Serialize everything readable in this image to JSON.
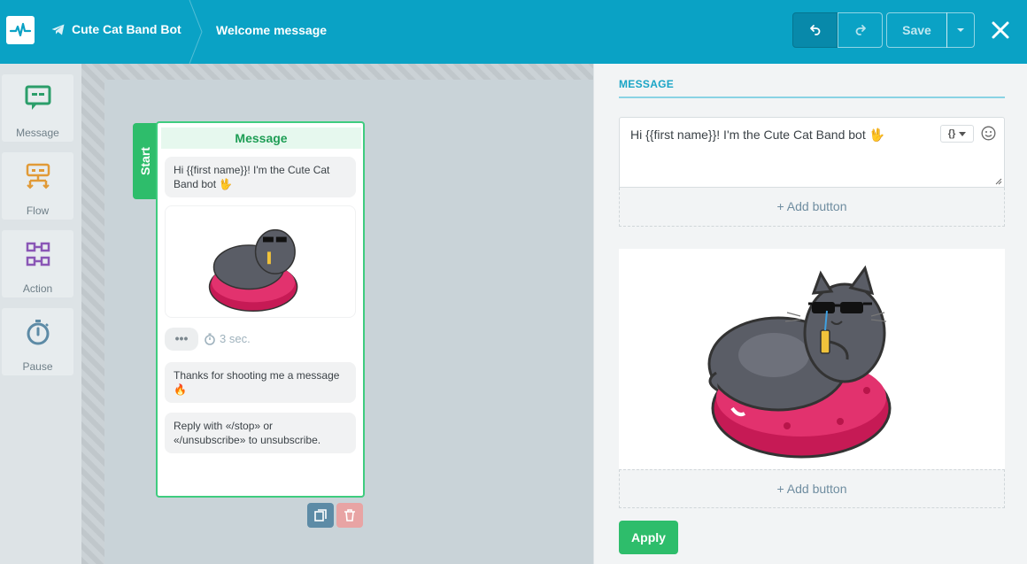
{
  "topbar": {
    "bot_name": "Cute Cat Band Bot",
    "page_title": "Welcome message",
    "save_label": "Save",
    "bg_color": "#0aa2c5"
  },
  "sidebar": {
    "items": [
      {
        "label": "Message",
        "icon": "message-icon"
      },
      {
        "label": "Flow",
        "icon": "flow-icon"
      },
      {
        "label": "Action",
        "icon": "action-icon"
      },
      {
        "label": "Pause",
        "icon": "stopwatch-icon"
      }
    ]
  },
  "node": {
    "start_label": "Start",
    "title": "Message",
    "greeting": "Hi {{first  name}}! I'm the Cute Cat Band bot 🖖",
    "delay": "3 sec.",
    "dots": "•••",
    "thanks": "Thanks for shooting me a message 🔥",
    "unsubscribe": "Reply with «/stop» or «/unsubscribe» to unsubscribe."
  },
  "panel": {
    "title": "MESSAGE",
    "message_text": "Hi {{first  name}}! I'm the Cute Cat Band bot 🖖",
    "variable_button": "{}",
    "add_button_label": "+ Add button",
    "add_button_label_2": "+ Add button",
    "apply_label": "Apply"
  },
  "colors": {
    "accent": "#0aa2c5",
    "green": "#2ebd6b",
    "node_border": "#3fcc7f"
  }
}
